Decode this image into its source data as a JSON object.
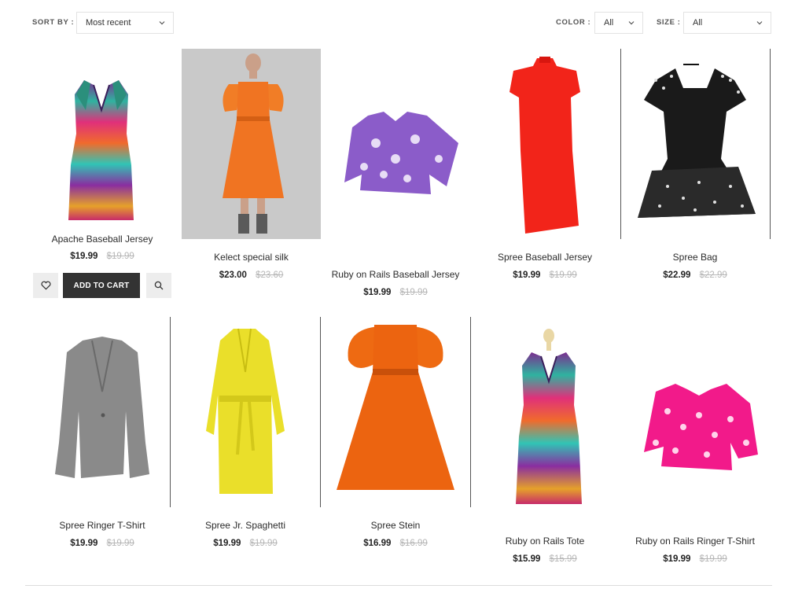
{
  "toolbar": {
    "sort_label": "SORT BY :",
    "sort_value": "Most recent",
    "color_label": "COLOR :",
    "color_value": "All",
    "size_label": "SIZE :",
    "size_value": "All"
  },
  "actions": {
    "add_to_cart": "ADD TO CART"
  },
  "products": [
    {
      "name": "Apache Baseball Jersey",
      "price": "$19.99",
      "old_price": "$19.99"
    },
    {
      "name": "Kelect special silk",
      "price": "$23.00",
      "old_price": "$23.60"
    },
    {
      "name": "Ruby on Rails Baseball Jersey",
      "price": "$19.99",
      "old_price": "$19.99"
    },
    {
      "name": "Spree Baseball Jersey",
      "price": "$19.99",
      "old_price": "$19.99"
    },
    {
      "name": "Spree Bag",
      "price": "$22.99",
      "old_price": "$22.99"
    },
    {
      "name": "Spree Ringer T-Shirt",
      "price": "$19.99",
      "old_price": "$19.99"
    },
    {
      "name": "Spree Jr. Spaghetti",
      "price": "$19.99",
      "old_price": "$19.99"
    },
    {
      "name": "Spree Stein",
      "price": "$16.99",
      "old_price": "$16.99"
    },
    {
      "name": "Ruby on Rails Tote",
      "price": "$15.99",
      "old_price": "$15.99"
    },
    {
      "name": "Ruby on Rails Ringer T-Shirt",
      "price": "$19.99",
      "old_price": "$19.99"
    }
  ],
  "colors": {
    "accent": "#333333",
    "muted": "#b6b6b6"
  }
}
